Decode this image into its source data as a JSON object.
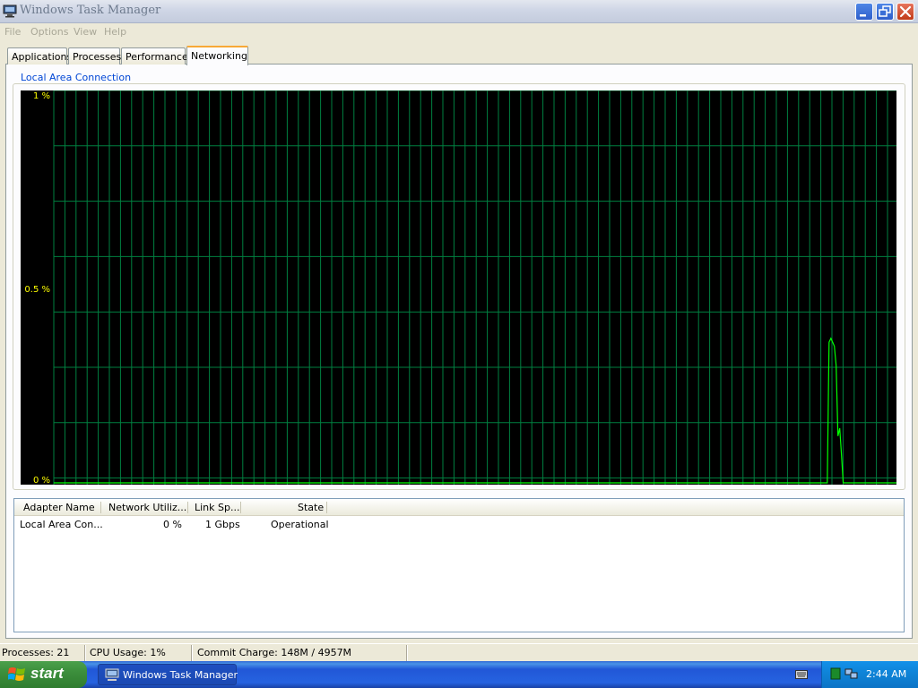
{
  "window": {
    "title": "Windows Task Manager",
    "icons": {
      "app": "task-manager-icon",
      "minimize": "minimize-icon",
      "maximize": "restore-icon",
      "close": "close-icon"
    }
  },
  "menu": {
    "items": [
      "File",
      "Options",
      "View",
      "Help"
    ]
  },
  "tabs": [
    "Applications",
    "Processes",
    "Performance",
    "Networking"
  ],
  "active_tab": "Networking",
  "graph": {
    "label": "Local Area Connection",
    "y_labels": {
      "top": "1 %",
      "mid": "0.5 %",
      "bottom": "0 %"
    },
    "colors": {
      "background": "#000000",
      "grid": "#008040",
      "line": "#00ff00",
      "axis_text": "#ffff00"
    }
  },
  "chart_data": {
    "type": "line",
    "ylim": [
      0,
      1
    ],
    "ylabel": "",
    "series": [
      {
        "points": [
          [
            0,
            0
          ],
          [
            872,
            0
          ],
          [
            874,
            0.36
          ],
          [
            876,
            0.37
          ],
          [
            878,
            0.36
          ],
          [
            880,
            0.35
          ],
          [
            882,
            0.3
          ],
          [
            884,
            0.12
          ],
          [
            886,
            0.14
          ],
          [
            888,
            0.07
          ],
          [
            890,
            0
          ],
          [
            950,
            0
          ]
        ]
      }
    ]
  },
  "adapters": {
    "columns": [
      "Adapter Name",
      "Network Utiliz...",
      "Link Sp...",
      "State"
    ],
    "rows": [
      {
        "name": "Local Area Con...",
        "utilization": "0 %",
        "link_speed": "1 Gbps",
        "state": "Operational"
      }
    ]
  },
  "status": {
    "processes": "Processes: 21",
    "cpu": "CPU Usage: 1%",
    "commit": "Commit Charge: 148M / 4957M"
  },
  "taskbar": {
    "start_label": "start",
    "task_label": "Windows Task Manager",
    "clock": "2:44 AM",
    "icons": {
      "start": "windows-logo-icon",
      "task": "task-manager-icon",
      "keyboard": "keyboard-icon",
      "tray1": "network-status-icon",
      "tray2": "network-connection-icon"
    }
  }
}
